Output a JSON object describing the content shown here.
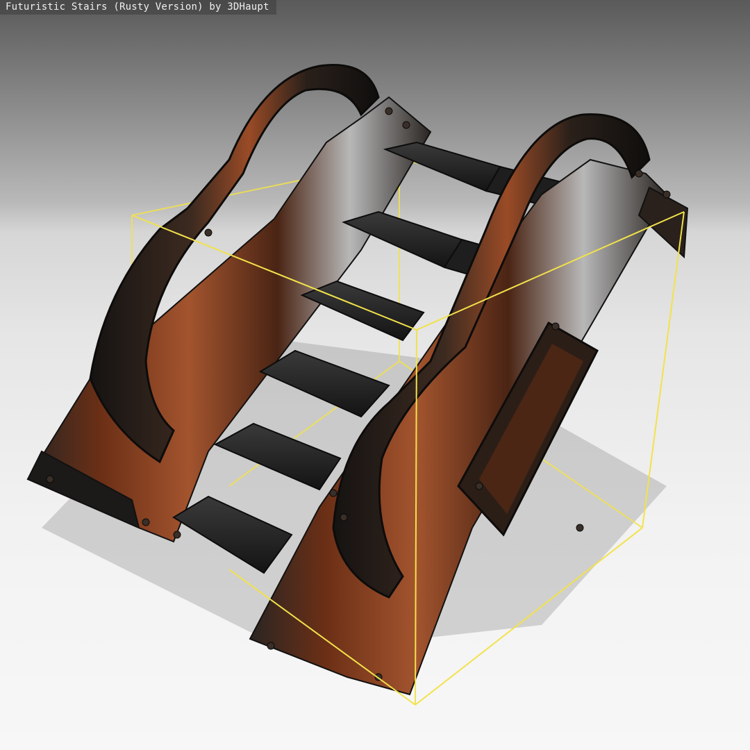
{
  "viewer": {
    "title": "Futuristic Stairs (Rusty Version) by 3DHaupt"
  },
  "colors": {
    "bounding_box": "#f2e24a",
    "rust": "#a3542e",
    "rust_dark": "#6b2f16",
    "metal_dark": "#1f1d1c",
    "metal_light": "#b8b8b8",
    "step": "#262626",
    "shadow": "#9e9e9e"
  }
}
